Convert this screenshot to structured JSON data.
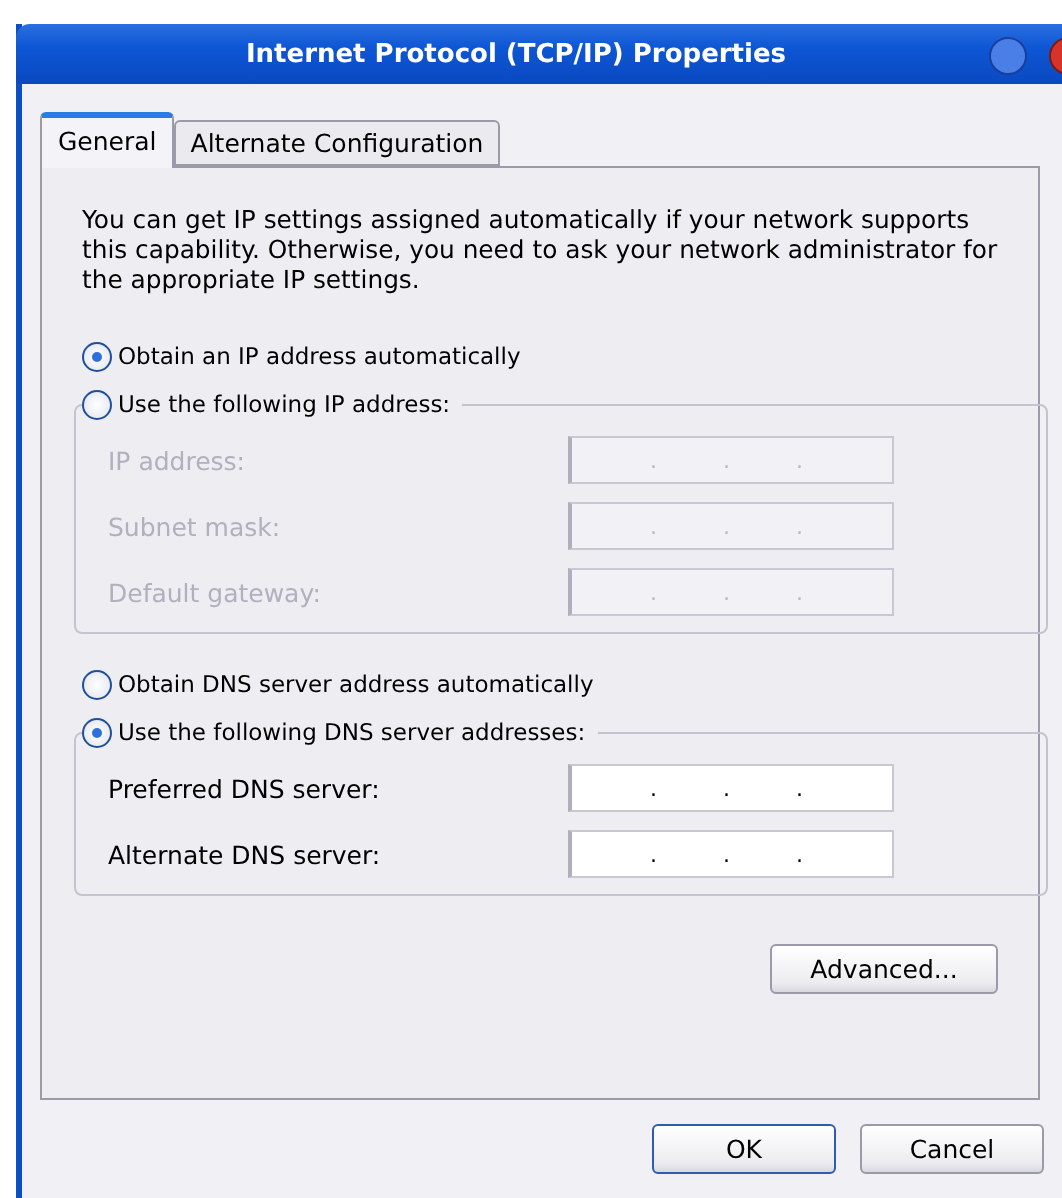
{
  "window": {
    "title": "Internet Protocol (TCP/IP) Properties"
  },
  "tabs": [
    {
      "label": "General",
      "selected": true
    },
    {
      "label": "Alternate Configuration",
      "selected": false
    }
  ],
  "description": "You can get IP settings assigned automatically if your network supports this capability. Otherwise, you need to ask your network administrator for the appropriate IP settings.",
  "sections": [
    {
      "auto_option": {
        "label": "Obtain an IP address automatically",
        "selected": true
      },
      "manual_option": {
        "label": "Use the following IP address:",
        "selected": false
      },
      "disabled": true,
      "fields": [
        {
          "label": "IP address:",
          "separators": [
            ".",
            ".",
            "."
          ]
        },
        {
          "label": "Subnet mask:",
          "separators": [
            ".",
            ".",
            "."
          ]
        },
        {
          "label": "Default gateway:",
          "separators": [
            ".",
            ".",
            "."
          ]
        }
      ]
    },
    {
      "auto_option": {
        "label": "Obtain DNS server address automatically",
        "selected": false
      },
      "manual_option": {
        "label": "Use the following DNS server addresses:",
        "selected": true
      },
      "disabled": false,
      "fields": [
        {
          "label": "Preferred DNS server:",
          "separators": [
            ".",
            ".",
            "."
          ]
        },
        {
          "label": "Alternate DNS server:",
          "separators": [
            ".",
            ".",
            "."
          ]
        }
      ]
    }
  ],
  "advanced_button": "Advanced...",
  "buttons": [
    {
      "label": "OK",
      "default": true
    },
    {
      "label": "Cancel",
      "default": false
    }
  ]
}
